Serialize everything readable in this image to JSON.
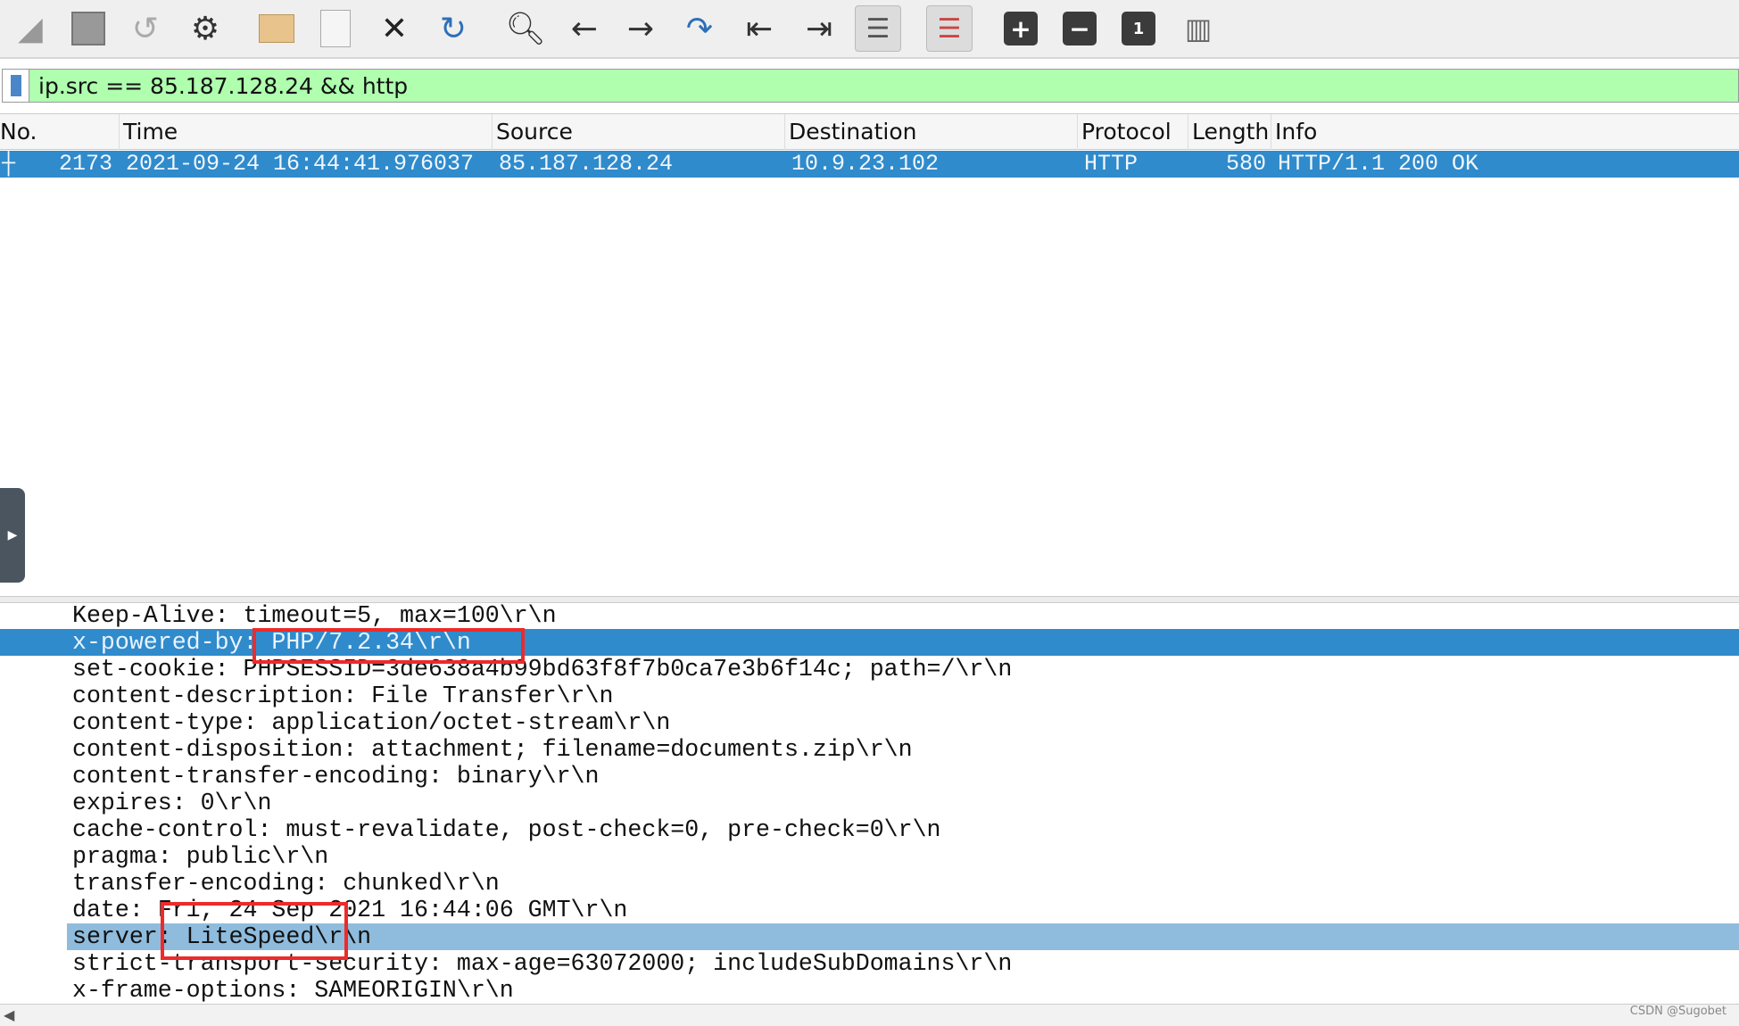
{
  "toolbar": {
    "icons": [
      "start-capture-icon",
      "stop-capture-icon",
      "restart-capture-icon",
      "capture-options-icon",
      "open-file-icon",
      "save-file-icon",
      "close-file-icon",
      "reload-file-icon",
      "find-packet-icon",
      "go-back-icon",
      "go-forward-icon",
      "go-to-packet-icon",
      "first-packet-icon",
      "last-packet-icon",
      "autoscroll-icon",
      "colorize-icon",
      "zoom-in-icon",
      "zoom-out-icon",
      "normal-size-icon",
      "resize-columns-icon"
    ],
    "zoom_in": "+",
    "zoom_out": "−",
    "normal": "1"
  },
  "filter": {
    "value": "ip.src == 85.187.128.24 && http"
  },
  "columns": [
    "No.",
    "Time",
    "Source",
    "Destination",
    "Protocol",
    "Length",
    "Info"
  ],
  "packet": {
    "no": "2173",
    "time": "2021-09-24 16:44:41.976037",
    "source": "85.187.128.24",
    "destination": "10.9.23.102",
    "protocol": "HTTP",
    "length": "580",
    "info": "HTTP/1.1 200 OK"
  },
  "details": [
    "Keep-Alive: timeout=5, max=100\\r\\n",
    "x-powered-by: PHP/7.2.34\\r\\n",
    "set-cookie: PHPSESSID=3de638a4b99bd63f8f7b0ca7e3b6f14c; path=/\\r\\n",
    "content-description: File Transfer\\r\\n",
    "content-type: application/octet-stream\\r\\n",
    "content-disposition: attachment; filename=documents.zip\\r\\n",
    "content-transfer-encoding: binary\\r\\n",
    "expires: 0\\r\\n",
    "cache-control: must-revalidate, post-check=0, pre-check=0\\r\\n",
    "pragma: public\\r\\n",
    "transfer-encoding: chunked\\r\\n",
    "date: Fri, 24 Sep 2021 16:44:06 GMT\\r\\n",
    "server: LiteSpeed\\r\\n",
    "strict-transport-security: max-age=63072000; includeSubDomains\\r\\n",
    "x-frame-options: SAMEORIGIN\\r\\n"
  ],
  "colors": {
    "selection": "#2f8bcb",
    "hover": "#8fbcdd",
    "filter_ok": "#afffaf",
    "annotation": "#ee2a2a"
  },
  "watermark": "CSDN @Sugobet"
}
